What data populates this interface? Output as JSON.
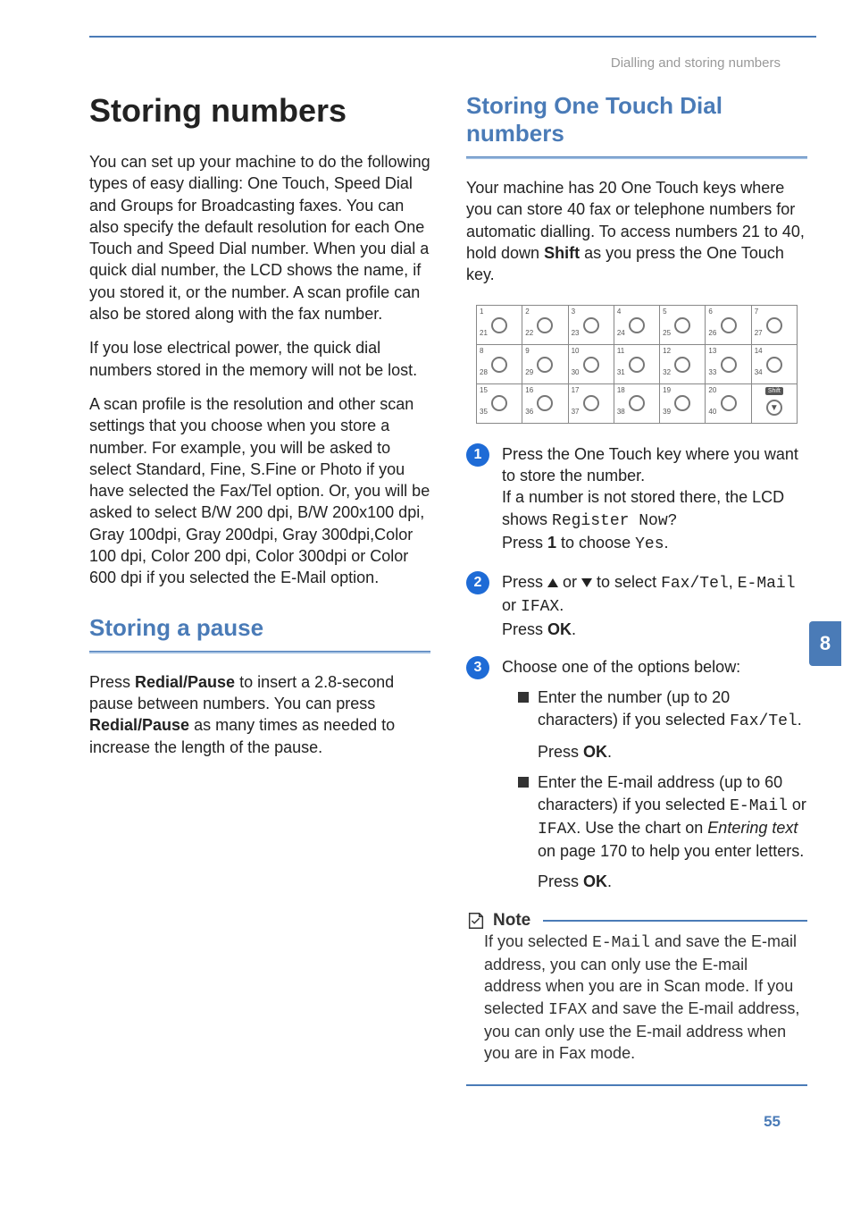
{
  "header": {
    "section_title": "Dialling and storing numbers"
  },
  "side_tab": {
    "chapter": "8"
  },
  "page_number": "55",
  "left": {
    "h1": "Storing numbers",
    "p1": "You can set up your machine to do the following types of easy dialling: One Touch, Speed Dial and Groups for Broadcasting faxes. You can also specify the default resolution for each One Touch and Speed Dial number. When you dial a quick dial number, the LCD shows the name, if you stored it, or the number. A scan profile can also be stored along with the fax number.",
    "p2": "If you lose electrical power, the quick dial numbers stored in the memory will not be lost.",
    "p3": "A scan profile is the resolution and other scan settings that you choose when you store a number. For example, you will be asked to select Standard, Fine, S.Fine or Photo if you have selected the Fax/Tel option. Or, you will be asked to select B/W 200 dpi, B/W 200x100 dpi, Gray 100dpi, Gray 200dpi, Gray 300dpi,Color 100 dpi, Color 200 dpi, Color 300dpi or Color 600 dpi if you selected the E-Mail option.",
    "h2": "Storing a pause",
    "p4_a": "Press ",
    "p4_b": "Redial/Pause",
    "p4_c": " to insert a 2.8-second pause between numbers. You can press ",
    "p4_d": "Redial/Pause",
    "p4_e": " as many times as needed to increase the length of the pause."
  },
  "right": {
    "h2": "Storing One Touch Dial numbers",
    "intro_a": "Your machine has 20 One Touch keys where you can store 40 fax or telephone numbers for automatic dialling. To access numbers 21 to 40, hold down ",
    "intro_b": "Shift",
    "intro_c": " as you press the One Touch key.",
    "keypad": {
      "rows": [
        {
          "top": [
            "1",
            "2",
            "3",
            "4",
            "5",
            "6",
            "7"
          ],
          "bottom": [
            "21",
            "22",
            "23",
            "24",
            "25",
            "26",
            "27"
          ]
        },
        {
          "top": [
            "8",
            "9",
            "10",
            "11",
            "12",
            "13",
            "14"
          ],
          "bottom": [
            "28",
            "29",
            "30",
            "31",
            "32",
            "33",
            "34"
          ]
        },
        {
          "top": [
            "15",
            "16",
            "17",
            "18",
            "19",
            "20",
            ""
          ],
          "bottom": [
            "35",
            "36",
            "37",
            "38",
            "39",
            "40",
            ""
          ],
          "shift_last": true,
          "shift_label": "Shift"
        }
      ]
    },
    "steps": {
      "s1": {
        "a": "Press the One Touch key where you want to store the number.",
        "b": "If a number is not stored there, the LCD shows ",
        "register": "Register Now?",
        "c": "Press ",
        "one": "1",
        "d": " to choose ",
        "yes": "Yes",
        "e": "."
      },
      "s2": {
        "a": "Press ",
        "b": " or ",
        "c": " to select ",
        "opt1": "Fax/Tel",
        "comma": ", ",
        "opt2": "E-Mail",
        "or": " or ",
        "opt3": "IFAX",
        "d": ".",
        "e": "Press ",
        "ok": "OK",
        "f": "."
      },
      "s3": {
        "intro": "Choose one of the options below:",
        "b1_a": "Enter the number (up to 20 characters) if you selected ",
        "b1_fax": "Fax/Tel",
        "b1_b": ".",
        "b1_c": "Press ",
        "b1_ok": "OK",
        "b1_d": ".",
        "b2_a": "Enter the E-mail address (up to 60 characters) if you selected ",
        "b2_em": "E-Mail",
        "b2_or": " or ",
        "b2_if": "IFAX",
        "b2_b": ". Use the chart on ",
        "b2_it": "Entering text",
        "b2_c": " on page 170 to help you enter letters.",
        "b2_d": "Press ",
        "b2_ok": "OK",
        "b2_e": "."
      }
    },
    "note": {
      "title": "Note",
      "body_a": "If you selected ",
      "em": "E-Mail",
      "body_b": " and save the E-mail address, you can only use the E-mail address when you are in Scan mode. If you selected ",
      "if": "IFAX",
      "body_c": " and save the E-mail address, you can only use the E-mail address when you are in Fax mode."
    }
  }
}
